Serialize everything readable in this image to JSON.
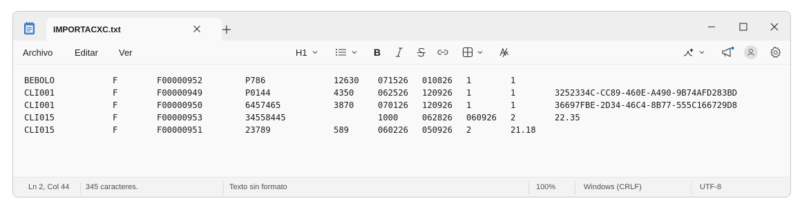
{
  "tab": {
    "title": "IMPORTACXC.txt"
  },
  "menu": {
    "file": "Archivo",
    "edit": "Editar",
    "view": "Ver"
  },
  "toolbar": {
    "heading_label": "H1",
    "icons": [
      "list-icon",
      "bold-icon",
      "italic-icon",
      "strikethrough-icon",
      "link-icon",
      "table-icon",
      "clear-formatting-icon",
      "copilot-icon",
      "announcement-icon",
      "account-icon",
      "settings-icon"
    ]
  },
  "editor": {
    "lines": [
      [
        "BEBOLO",
        "F",
        "F00000952",
        "P786",
        "12630",
        "071526",
        "010826",
        "1",
        "1",
        ""
      ],
      [
        "CLI001",
        "F",
        "F00000949",
        "P0144",
        "4350",
        "062526",
        "120926",
        "1",
        "1",
        "3252334C-CC89-460E-A490-9B74AFD283BD"
      ],
      [
        "CLI001",
        "F",
        "F00000950",
        "6457465",
        "3870",
        "070126",
        "120926",
        "1",
        "1",
        "36697FBE-2D34-46C4-8B77-555C166729D8"
      ],
      [
        "CLI015",
        "F",
        "F00000953",
        "34558445",
        "",
        "1000",
        "062826",
        "060926",
        "2",
        "22.35"
      ],
      [
        "CLI015",
        "F",
        "F00000951",
        "23789",
        "589",
        "060226",
        "050926",
        "2",
        "21.18",
        ""
      ]
    ]
  },
  "status": {
    "position": "Ln 2, Col 44",
    "characters": "345 caracteres.",
    "format": "Texto sin formato",
    "zoom": "100%",
    "line_endings": "Windows (CRLF)",
    "encoding": "UTF-8"
  },
  "colors": {
    "accent": "#0067c0",
    "notification_dot": "#0078d4"
  }
}
